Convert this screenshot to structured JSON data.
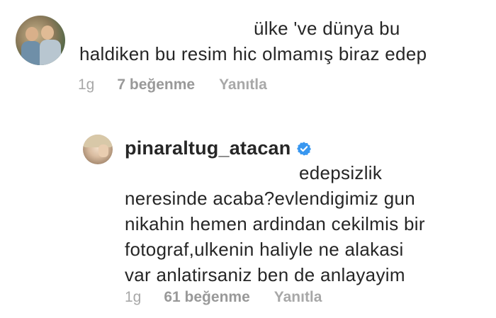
{
  "comments": [
    {
      "lines": [
        "ülke 've dünya bu",
        "haldiken bu resim hic olmamış biraz edep"
      ],
      "time": "1g",
      "likes": "7 beğenme",
      "reply": "Yanıtla"
    },
    {
      "username": "pinaraltug_atacan",
      "verified": true,
      "lines": [
        "edepsizlik",
        "neresinde acaba?evlendigimiz gun",
        "nikahin hemen ardindan cekilmis bir",
        "fotograf,ulkenin haliyle ne alakasi",
        "var anlatirsaniz ben de anlayayim"
      ],
      "time": "1g",
      "likes": "61 beğenme",
      "reply": "Yanıtla"
    }
  ],
  "colors": {
    "text": "#262626",
    "meta": "#a8a8a8",
    "verified": "#3897f0"
  }
}
